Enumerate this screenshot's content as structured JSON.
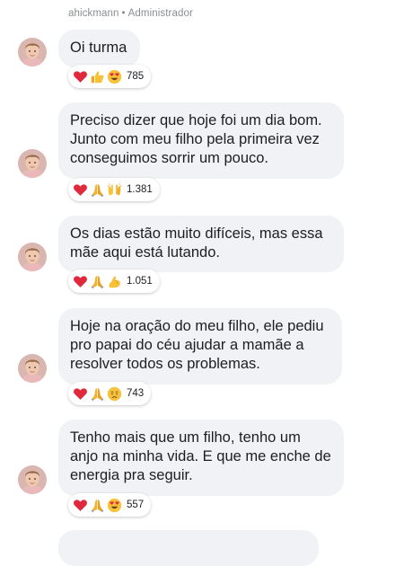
{
  "header": {
    "username": "ahickmann",
    "separator": "•",
    "role": "Administrador"
  },
  "messages": [
    {
      "text": "Oi turma",
      "reactions": [
        "heart",
        "thumbs-up",
        "heart-eyes"
      ],
      "count": "785"
    },
    {
      "text": "Preciso dizer que hoje foi um dia bom.\nJunto com meu filho pela primeira vez\nconseguimos sorrir um pouco.",
      "reactions": [
        "heart",
        "praying-hands",
        "raised-hands"
      ],
      "count": "1.381"
    },
    {
      "text": "Os dias estão muito difíceis, mas essa\nmãe aqui está lutando.",
      "reactions": [
        "heart",
        "praying-hands",
        "flexed-biceps"
      ],
      "count": "1.051"
    },
    {
      "text": "Hoje na oração do meu filho, ele pediu\npro papai do céu ajudar a mamãe a\nresolver todos os problemas.",
      "reactions": [
        "heart",
        "praying-hands",
        "crying-face"
      ],
      "count": "743"
    },
    {
      "text": "Tenho mais que um filho, tenho um\nanjo na minha vida. E que me enche de\nenergia pra seguir.",
      "reactions": [
        "heart",
        "praying-hands",
        "heart-eyes"
      ],
      "count": "557"
    }
  ],
  "colors": {
    "bubble": "#f0f2f5",
    "text": "#1c1e21",
    "meta": "#8a8d91",
    "heart": "#e02a3c",
    "emoji_yellow": "#f7c23a"
  }
}
